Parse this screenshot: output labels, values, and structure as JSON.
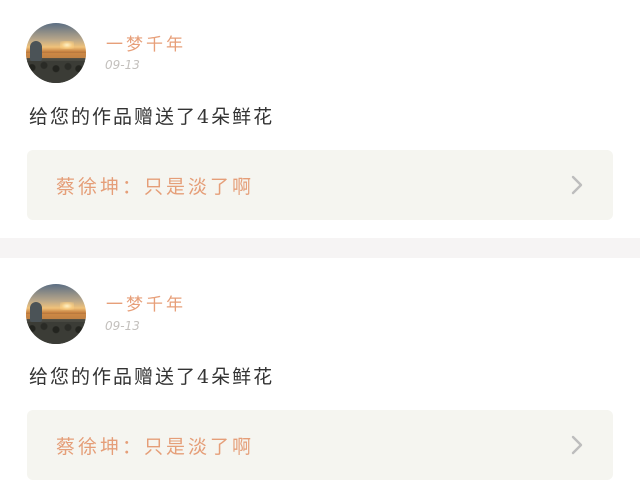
{
  "feed": {
    "items": [
      {
        "username": "一梦千年",
        "timestamp": "09-13",
        "message": "给您的作品赠送了4朵鲜花",
        "reply": {
          "author": "蔡徐坤",
          "separator": "：",
          "text": "只是淡了啊"
        },
        "chevron_icon": "chevron-right-icon"
      },
      {
        "username": "一梦千年",
        "timestamp": "09-13",
        "message": "给您的作品赠送了4朵鲜花",
        "reply": {
          "author": "蔡徐坤",
          "separator": "：",
          "text": "只是淡了啊"
        },
        "chevron_icon": "chevron-right-icon"
      }
    ]
  },
  "colors": {
    "username": "#e79f79",
    "reply_text": "#e59e78",
    "timestamp": "#c3c0bd",
    "message": "#333333",
    "reply_background": "#f5f5f0",
    "separator_background": "#f6f4f4",
    "chevron": "#bdbdbd"
  }
}
